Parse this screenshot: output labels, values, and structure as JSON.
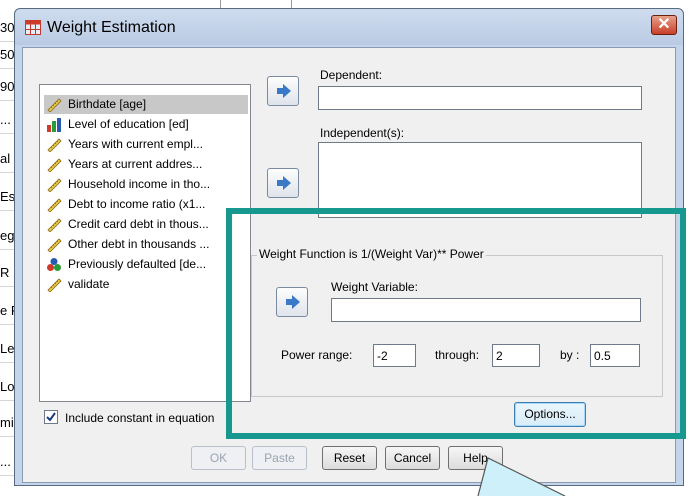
{
  "background": {
    "rows": [
      "30",
      "50",
      "90",
      "...",
      "al I",
      "Est",
      "eg",
      "R",
      "e F",
      "Lea",
      "Lo",
      "mia",
      "..."
    ]
  },
  "dialog": {
    "title": "Weight Estimation",
    "close_label": "✕",
    "variables": [
      {
        "label": "Birthdate [age]",
        "icon": "scale-icon",
        "selected": true
      },
      {
        "label": "Level of education [ed]",
        "icon": "bar-chart-icon"
      },
      {
        "label": "Years with current empl...",
        "icon": "scale-icon"
      },
      {
        "label": "Years at current addres...",
        "icon": "scale-icon"
      },
      {
        "label": "Household income in tho...",
        "icon": "scale-icon"
      },
      {
        "label": "Debt to income ratio (x1...",
        "icon": "scale-icon"
      },
      {
        "label": "Credit card debt in thous...",
        "icon": "scale-icon"
      },
      {
        "label": "Other debt in thousands ...",
        "icon": "scale-icon"
      },
      {
        "label": "Previously defaulted [de...",
        "icon": "nominal-icon"
      },
      {
        "label": "validate",
        "icon": "scale-icon"
      }
    ],
    "dependent": {
      "label": "Dependent:",
      "value": ""
    },
    "independents": {
      "label": "Independent(s):",
      "value": ""
    },
    "weight_group": {
      "title": "Weight Function is 1/(Weight Var)** Power",
      "weight_variable_label": "Weight Variable:",
      "weight_variable_value": "",
      "power_range_label": "Power range:",
      "power_from": "-2",
      "through_label": "through:",
      "power_to": "2",
      "by_label": "by :",
      "power_step": "0.5"
    },
    "include_constant": {
      "label": "Include constant in equation",
      "checked": true
    },
    "buttons": {
      "options": "Options...",
      "ok": "OK",
      "paste": "Paste",
      "reset": "Reset",
      "cancel": "Cancel",
      "help": "Help"
    }
  },
  "colors": {
    "highlight": "#16988f",
    "accent_arrow": "#3a78c8"
  }
}
